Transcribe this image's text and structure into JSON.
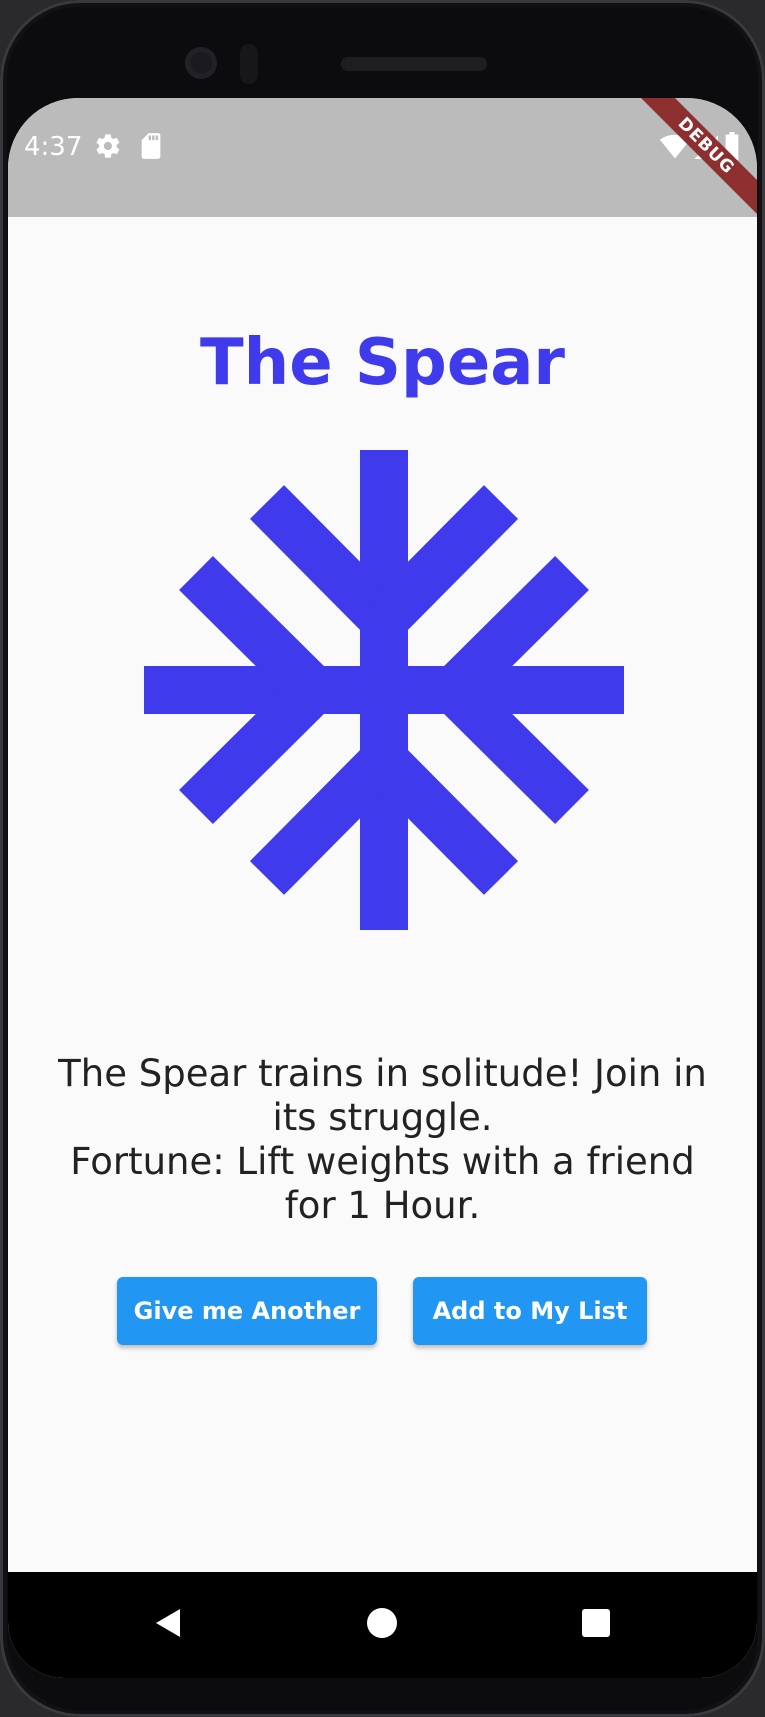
{
  "status_bar": {
    "time": "4:37",
    "icons": [
      "gear-icon",
      "sd-card-icon",
      "wifi-icon",
      "signal-icon",
      "battery-icon"
    ],
    "debug_label": "DEBUG"
  },
  "page": {
    "title": "The Spear",
    "symbol_icon": "spear-rune-icon",
    "description_lines": [
      "The Spear trains in solitude! Join in its struggle.",
      "Fortune: Lift weights with a friend for 1 Hour."
    ]
  },
  "buttons": {
    "another_label": "Give me Another",
    "add_label": "Add to My List"
  },
  "nav_bar": {
    "icons": [
      "back-icon",
      "home-icon",
      "recents-icon"
    ]
  },
  "colors": {
    "accent": "#3f3aeb",
    "button": "#2196f3",
    "status_bar": "#bbbbbb",
    "background": "#fafafa"
  }
}
